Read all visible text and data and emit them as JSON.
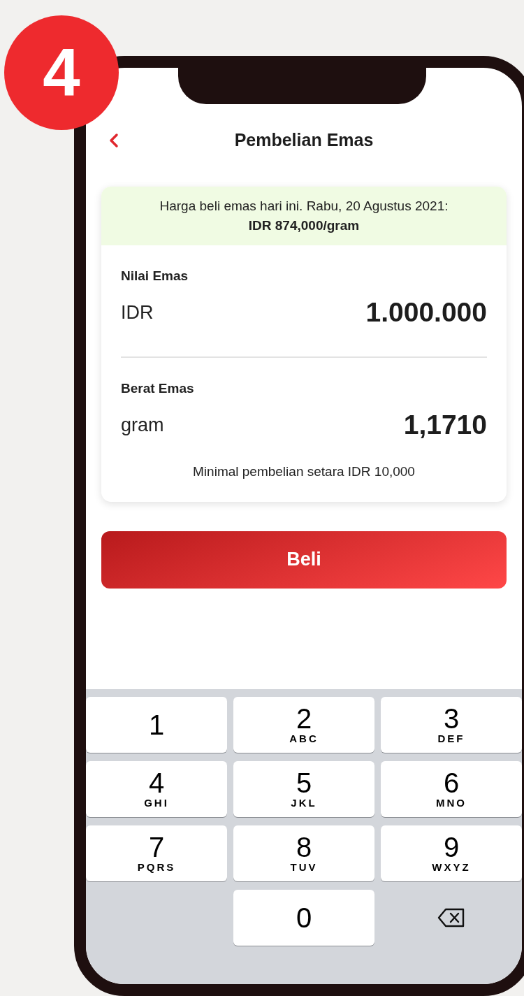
{
  "step_badge": "4",
  "header": {
    "title": "Pembelian Emas"
  },
  "price_banner": {
    "text": "Harga beli emas hari ini. Rabu, 20 Agustus 2021:",
    "price": "IDR 874,000/gram"
  },
  "fields": [
    {
      "label": "Nilai Emas",
      "unit": "IDR",
      "value": "1.000.000"
    },
    {
      "label": "Berat Emas",
      "unit": "gram",
      "value": "1,1710"
    }
  ],
  "note": "Minimal pembelian setara IDR 10,000",
  "buy_button": "Beli",
  "keypad": [
    {
      "kind": "digit",
      "digit": "1"
    },
    {
      "kind": "digit",
      "digit": "2",
      "letters": "ABC"
    },
    {
      "kind": "digit",
      "digit": "3",
      "letters": "DEF"
    },
    {
      "kind": "digit",
      "digit": "4",
      "letters": "GHI"
    },
    {
      "kind": "digit",
      "digit": "5",
      "letters": "JKL"
    },
    {
      "kind": "digit",
      "digit": "6",
      "letters": "MNO"
    },
    {
      "kind": "digit",
      "digit": "7",
      "letters": "PQRS"
    },
    {
      "kind": "digit",
      "digit": "8",
      "letters": "TUV"
    },
    {
      "kind": "digit",
      "digit": "9",
      "letters": "WXYZ"
    },
    {
      "kind": "empty"
    },
    {
      "kind": "digit",
      "digit": "0"
    },
    {
      "kind": "delete"
    }
  ]
}
